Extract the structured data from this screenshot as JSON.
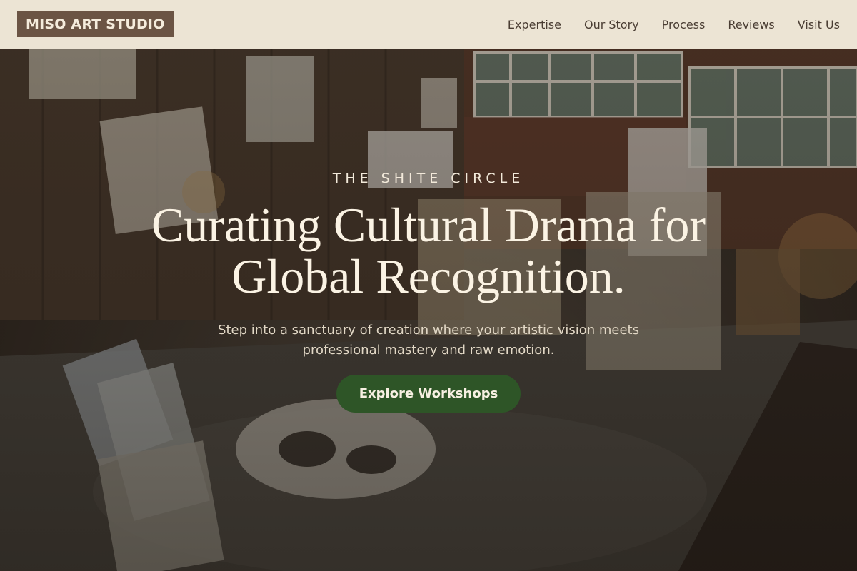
{
  "brand": {
    "name": "MISO ART STUDIO"
  },
  "nav": {
    "items": [
      {
        "label": "Expertise"
      },
      {
        "label": "Our Story"
      },
      {
        "label": "Process"
      },
      {
        "label": "Reviews"
      },
      {
        "label": "Visit Us"
      }
    ]
  },
  "hero": {
    "eyebrow": "THE SHITE CIRCLE",
    "headline_line1": "Curating Cultural Drama for",
    "headline_line2": "Global Recognition.",
    "subtext_line1": "Step into a sanctuary of creation where your artistic vision meets",
    "subtext_line2": "professional mastery and raw emotion.",
    "cta_label": "Explore Workshops"
  },
  "colors": {
    "header_bg": "#ece4d4",
    "logo_bg": "#6b5444",
    "cta_bg": "#2e5527",
    "text_light": "#fbf3e4"
  }
}
